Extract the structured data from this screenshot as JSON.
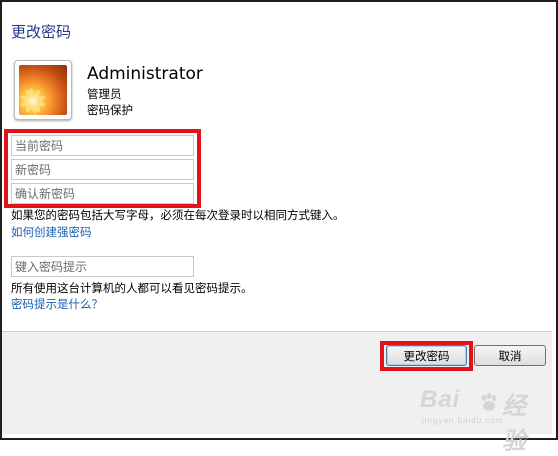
{
  "dialog": {
    "title": "更改密码"
  },
  "user": {
    "name": "Administrator",
    "role": "管理员",
    "protection": "密码保护"
  },
  "fields": {
    "current_password_placeholder": "当前密码",
    "new_password_placeholder": "新密码",
    "confirm_password_placeholder": "确认新密码",
    "hint_placeholder": "键入密码提示"
  },
  "texts": {
    "case_warning": "如果您的密码包括大写字母，必须在每次登录时以相同方式键入。",
    "strong_password_link": "如何创建强密码",
    "hint_info": "所有使用这台计算机的人都可以看见密码提示。",
    "hint_link": "密码提示是什么？"
  },
  "buttons": {
    "change_password": "更改密码",
    "cancel": "取消"
  },
  "watermark": {
    "text": "Bai",
    "text2": "经验",
    "sub": "jingyan.baidu.com"
  },
  "colors": {
    "accent_title": "#1f3b8a",
    "link": "#1a5fb4",
    "highlight": "#e3131a"
  }
}
